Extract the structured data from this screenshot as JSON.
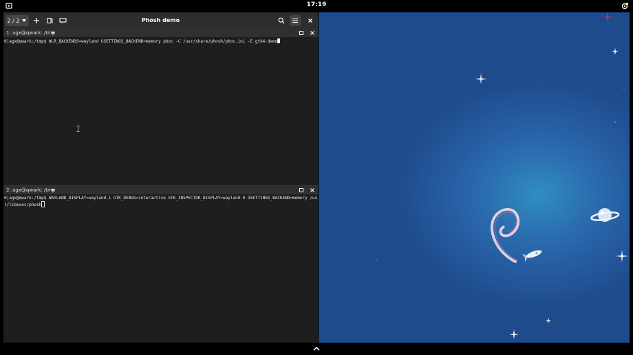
{
  "topbar": {
    "clock": "17:19"
  },
  "terminal": {
    "tab_counter": "2 / 2",
    "window_title": "Phosh demo",
    "panes": [
      {
        "title": "1: agx@qwark: /tmp",
        "command": "0|agx@qwark:/tmp$ WLR_BACKENDS=wayland GSETTINGS_BACKEND=memory phoc -C /usr/share/phosh/phoc.ini -E gtk4-demo"
      },
      {
        "title": "2: agx@qwark: /tmp",
        "command": "0|agx@qwark:/tmp$ WAYLAND_DISPLAY=wayland-1 GTK_DEBUG=interactive GTK_INSPECTOR_DISPLAY=wayland-0 GSETTINGS_BACKEND=memory /usr/libexec/phosh"
      }
    ]
  },
  "icons": {
    "topbar_left": "screen-share-icon",
    "topbar_right": "settings-icon",
    "new_tab": "plus-icon",
    "split": "split-icon",
    "tab_overview": "tab-overview-icon",
    "search": "search-icon",
    "menu": "hamburger-menu-icon",
    "close": "close-icon",
    "pane_maximize": "maximize-icon",
    "pane_close": "close-icon",
    "bottom_handle": "chevron-up-icon"
  },
  "colors": {
    "terminal_bg": "#1e1e1e",
    "headerbar_bg": "#2d2d2d",
    "wallpaper_blue": "#275ea3"
  }
}
